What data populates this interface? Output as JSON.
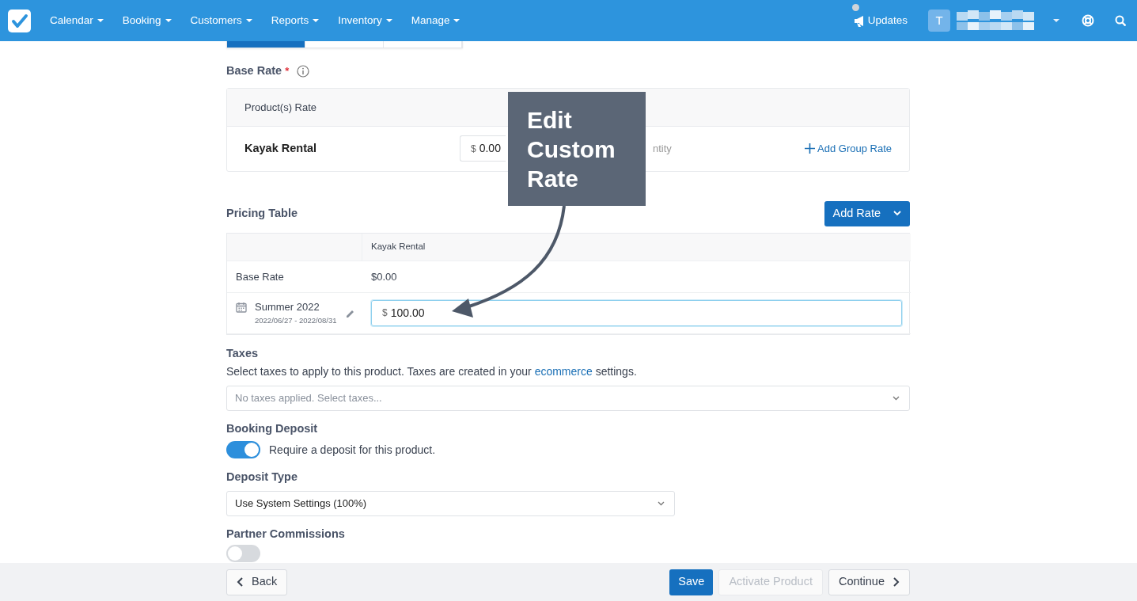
{
  "navbar": {
    "menus": [
      {
        "label": "Calendar"
      },
      {
        "label": "Booking"
      },
      {
        "label": "Customers"
      },
      {
        "label": "Reports"
      },
      {
        "label": "Inventory"
      },
      {
        "label": "Manage"
      }
    ],
    "updates": {
      "label": "Updates",
      "unread": true
    },
    "user": {
      "initial": "T"
    }
  },
  "tab_strip": [
    {
      "selected": true
    },
    {
      "selected": false
    },
    {
      "selected": false
    }
  ],
  "base_rate": {
    "title": "Base Rate",
    "required": "*",
    "header": "Product(s) Rate",
    "product": "Kayak Rental",
    "currency": "$",
    "amount": "0.00",
    "hidden_label_end": "ntity",
    "add_link": "Add Group Rate"
  },
  "pricing_table": {
    "title": "Pricing Table",
    "add_button": "Add Rate",
    "column": "Kayak Rental",
    "rows": [
      {
        "kind": "base",
        "label": "Base Rate",
        "value": "$0.00"
      },
      {
        "kind": "custom",
        "label": "Summer 2022",
        "dates": "2022/06/27 - 2022/08/31",
        "currency": "$",
        "value": "100.00",
        "focused": true
      }
    ]
  },
  "taxes": {
    "title": "Taxes",
    "text_before": "Select taxes to apply to this product. Taxes are created in your ",
    "link": "ecommerce",
    "text_after": " settings.",
    "placeholder": "No taxes applied. Select taxes..."
  },
  "booking_deposit": {
    "title": "Booking Deposit",
    "on": true,
    "label": "Require a deposit for this product."
  },
  "deposit_type": {
    "title": "Deposit Type",
    "value": "Use System Settings (100%)"
  },
  "partner_commissions": {
    "title": "Partner Commissions",
    "on": false
  },
  "callout": {
    "text": "Edit Custom Rate"
  },
  "footer": {
    "back": "Back",
    "save": "Save",
    "activate": {
      "label": "Activate Product",
      "disabled": true
    },
    "continue": "Continue"
  }
}
